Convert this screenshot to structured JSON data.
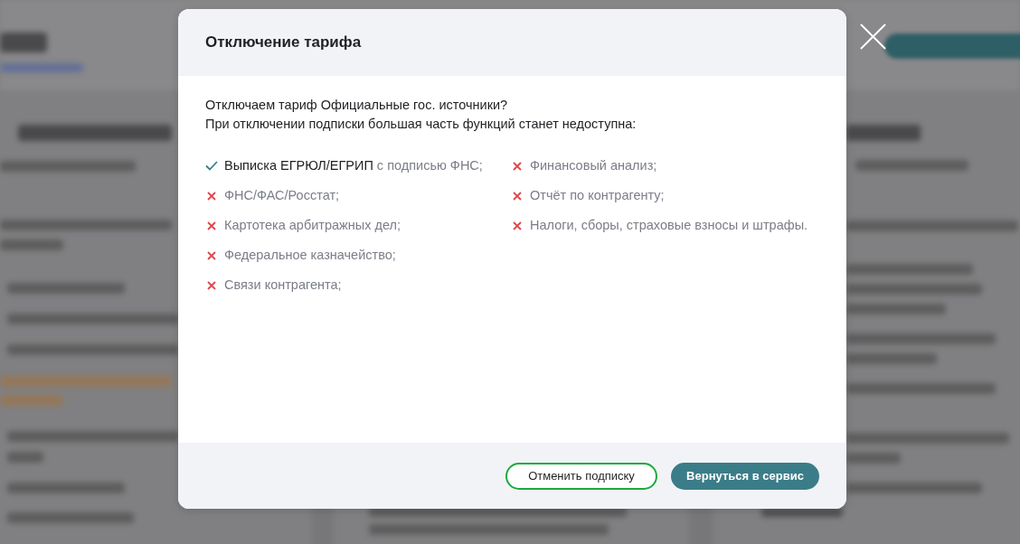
{
  "dialog": {
    "title": "Отключение тарифа",
    "question": "Отключаем тариф Официальные гос. источники?",
    "warning": "При отключении подписки большая часть функций станет недоступна:",
    "feature_columns": [
      {
        "items": [
          {
            "included": true,
            "label": "Выписка ЕГРЮЛ/ЕГРИП",
            "note": "с подписью ФНС;"
          },
          {
            "included": false,
            "label": "ФНС/ФАС/Росстат;"
          },
          {
            "included": false,
            "label": "Картотека арбитражных дел;"
          },
          {
            "included": false,
            "label": "Федеральное казначейство;"
          },
          {
            "included": false,
            "label": "Связи контрагента;"
          }
        ]
      },
      {
        "items": [
          {
            "included": false,
            "label": "Финансовый анализ;"
          },
          {
            "included": false,
            "label": "Отчёт по контрагенту;"
          },
          {
            "included": false,
            "label": "Налоги, сборы, страховые взносы и штрафы."
          }
        ]
      }
    ],
    "buttons": [
      {
        "label": "Отменить подписку",
        "kind": "outline"
      },
      {
        "label": "Вернуться в сервис",
        "kind": "primary"
      }
    ]
  }
}
